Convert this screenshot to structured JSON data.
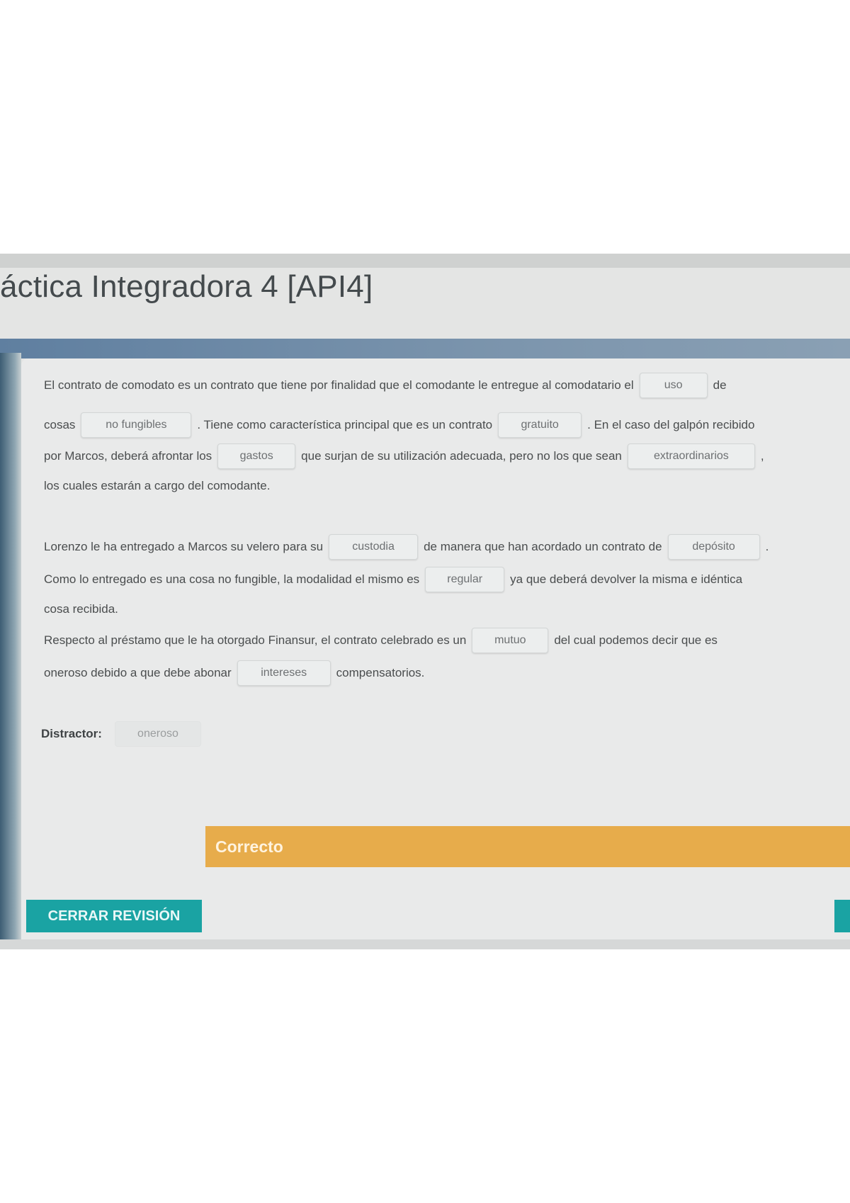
{
  "page": {
    "title": "áctica Integradora 4 [API4]"
  },
  "paragraph1": {
    "line1": {
      "a": "El contrato de comodato es un contrato que tiene por finalidad que el comodante le entregue al comodatario el",
      "blank1": "uso",
      "b": "de"
    },
    "line2": {
      "a": "cosas",
      "blank2": "no fungibles",
      "b": ". Tiene como característica principal que es un contrato",
      "blank3": "gratuito",
      "c": ". En el caso del galpón recibido"
    },
    "line3": {
      "a": "por Marcos, deberá afrontar los",
      "blank4": "gastos",
      "b": "que surjan de su utilización adecuada, pero no los que sean",
      "blank5": "extraordinarios",
      "c": ","
    },
    "line4": {
      "a": "los cuales estarán a cargo del comodante."
    }
  },
  "paragraph2": {
    "line1": {
      "a": "Lorenzo le ha entregado a Marcos su velero para su",
      "blank1": "custodia",
      "b": "de manera que han acordado un contrato de",
      "blank2": "depósito",
      "c": "."
    },
    "line2": {
      "a": "Como lo entregado es una cosa no fungible, la modalidad el mismo es",
      "blank3": "regular",
      "b": "ya que deberá devolver la misma e idéntica"
    },
    "line3": {
      "a": "cosa recibida."
    },
    "line4": {
      "a": "Respecto al préstamo que le ha otorgado Finansur, el contrato celebrado es un",
      "blank4": "mutuo",
      "b": "del cual podemos decir que es"
    },
    "line5": {
      "a": "oneroso debido a que debe abonar",
      "blank5": "intereses",
      "b": "compensatorios."
    }
  },
  "distractor": {
    "label": "Distractor:",
    "value": "oneroso"
  },
  "feedback": {
    "text": "Correcto"
  },
  "buttons": {
    "close_review": "CERRAR REVISIÓN"
  },
  "colors": {
    "feedback_bar": "#e7ac4b",
    "primary_button": "#1aa3a3",
    "header_band": "#6f8aa6"
  }
}
